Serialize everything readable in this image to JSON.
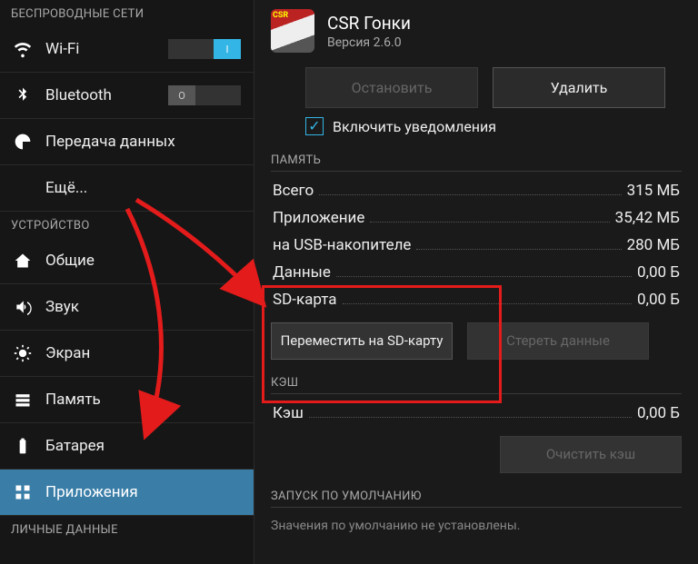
{
  "sidebar": {
    "sections": {
      "wireless": "БЕСПРОВОДНЫЕ СЕТИ",
      "device": "УСТРОЙСТВО",
      "personal": "ЛИЧНЫЕ ДАННЫЕ"
    },
    "items": {
      "wifi": "Wi-Fi",
      "bluetooth": "Bluetooth",
      "data": "Передача данных",
      "more": "Ещё...",
      "general": "Общие",
      "sound": "Звук",
      "display": "Экран",
      "storage": "Память",
      "battery": "Батарея",
      "apps": "Приложения"
    }
  },
  "app": {
    "icon_text": "CSR",
    "title": "CSR Гонки",
    "version": "Версия 2.6.0"
  },
  "buttons": {
    "stop": "Остановить",
    "uninstall": "Удалить",
    "move_sd": "Переместить на SD-карту",
    "clear_data": "Стереть данные",
    "clear_cache": "Очистить кэш"
  },
  "checkbox": {
    "notifications": "Включить уведомления"
  },
  "sections": {
    "memory": "ПАМЯТЬ",
    "cache": "КЭШ",
    "launch": "ЗАПУСК ПО УМОЛЧАНИЮ"
  },
  "rows": {
    "total": {
      "label": "Всего",
      "value": "315 МБ"
    },
    "app_size": {
      "label": "Приложение",
      "value": "35,42 МБ"
    },
    "usb": {
      "label": "на USB-накопителе",
      "value": "280 МБ"
    },
    "data": {
      "label": "Данные",
      "value": "0,00 Б"
    },
    "sd": {
      "label": "SD-карта",
      "value": "0,00 Б"
    },
    "cache": {
      "label": "Кэш",
      "value": "0,00 Б"
    }
  },
  "footnote": "Значения по умолчанию не установлены."
}
